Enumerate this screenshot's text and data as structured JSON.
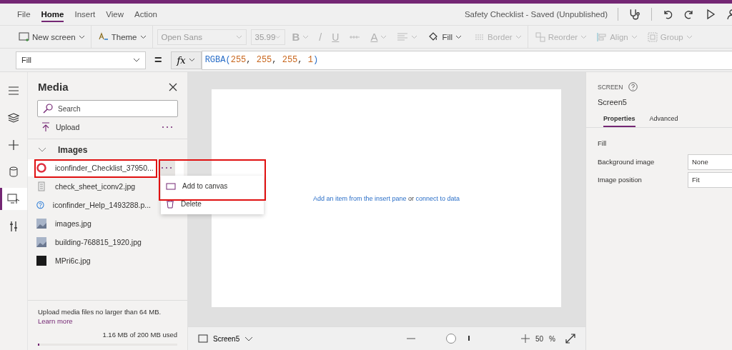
{
  "menu_tabs": [
    {
      "label": "File",
      "selected": false
    },
    {
      "label": "Home",
      "selected": true
    },
    {
      "label": "Insert",
      "selected": false
    },
    {
      "label": "View",
      "selected": false
    },
    {
      "label": "Action",
      "selected": false
    }
  ],
  "doc_title": "Safety Checklist - Saved (Unpublished)",
  "toolbar": [
    {
      "kind": "new-screen",
      "label": "New screen",
      "disabled": false
    },
    {
      "kind": "theme",
      "label": "Theme",
      "disabled": false
    },
    {
      "kind": "font",
      "label": "Open Sans",
      "disabled": true
    },
    {
      "kind": "size",
      "label": "35.99",
      "disabled": true
    },
    {
      "kind": "bold",
      "label": "B",
      "disabled": true
    },
    {
      "kind": "italic",
      "label": "/",
      "disabled": true
    },
    {
      "kind": "underline",
      "label": "U",
      "disabled": true
    },
    {
      "kind": "strike",
      "disabled": true
    },
    {
      "kind": "font-color",
      "label": "A",
      "disabled": true
    },
    {
      "kind": "text-align",
      "disabled": true
    },
    {
      "kind": "fill",
      "label": "Fill",
      "disabled": false
    },
    {
      "kind": "border",
      "label": "Border",
      "disabled": true
    },
    {
      "kind": "reorder",
      "label": "Reorder",
      "disabled": true
    },
    {
      "kind": "align",
      "label": "Align",
      "disabled": true
    },
    {
      "kind": "group",
      "label": "Group",
      "disabled": true
    }
  ],
  "formula_bar": {
    "property": "Fill",
    "equals": "=",
    "fx": "fx",
    "tokens": [
      {
        "text": "RGBA(",
        "kind": "function"
      },
      {
        "text": "255",
        "kind": "number"
      },
      {
        "text": ", ",
        "kind": "punct"
      },
      {
        "text": "255",
        "kind": "number"
      },
      {
        "text": ", ",
        "kind": "punct"
      },
      {
        "text": "255",
        "kind": "number"
      },
      {
        "text": ", ",
        "kind": "punct"
      },
      {
        "text": "1",
        "kind": "number"
      },
      {
        "text": ")",
        "kind": "function"
      }
    ]
  },
  "rail": [
    {
      "kind": "menu",
      "selected": false
    },
    {
      "kind": "tree",
      "selected": false
    },
    {
      "kind": "insert",
      "selected": false
    },
    {
      "kind": "data",
      "selected": false
    },
    {
      "kind": "media",
      "selected": true
    },
    {
      "kind": "tools",
      "selected": false
    }
  ],
  "media": {
    "title": "Media",
    "search": {
      "placeholder": "Search"
    },
    "upload": "Upload",
    "section": "Images",
    "expanded": true,
    "files": [
      {
        "name": "iconfinder_Checklist_37950...",
        "kind": "ring",
        "selected": true
      },
      {
        "name": "check_sheet_iconv2.jpg",
        "kind": "sheet",
        "selected": false
      },
      {
        "name": "iconfinder_Help_1493288.p...",
        "kind": "help",
        "selected": false
      },
      {
        "name": "images.jpg",
        "kind": "photo",
        "selected": false
      },
      {
        "name": "building-768815_1920.jpg",
        "kind": "photo",
        "selected": false
      },
      {
        "name": "MPri6c.jpg",
        "kind": "dark",
        "selected": false
      }
    ],
    "context_menu": [
      {
        "label": "Add to canvas",
        "kind": "add"
      },
      {
        "label": "Delete",
        "kind": "delete"
      }
    ],
    "note": "Upload media files no larger than 64 MB.",
    "link": "Learn more",
    "usage": "1.16 MB of 200 MB used",
    "level": 0.01
  },
  "canvas": {
    "hint_link": "Add an item from the insert pane",
    "hint_or": "or",
    "hint_link2": "connect to data"
  },
  "bottom_bar": {
    "screen": "Screen5",
    "level": 0.3,
    "zoom": "50",
    "unit": "%"
  },
  "properties": {
    "kind_label": "SCREEN",
    "name": "Screen5",
    "tabs": [
      {
        "label": "Properties",
        "selected": true
      },
      {
        "label": "Advanced",
        "selected": false
      }
    ],
    "fill_label": "Fill",
    "rows": [
      {
        "label": "Background image",
        "value": "None"
      },
      {
        "label": "Image position",
        "value": "Fit"
      }
    ]
  }
}
